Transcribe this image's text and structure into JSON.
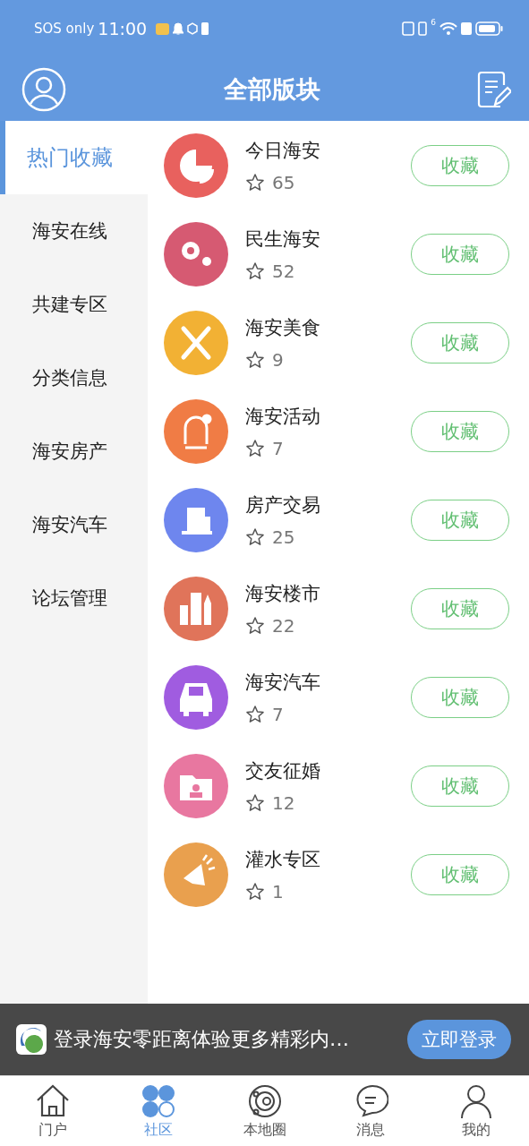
{
  "status_bar": {
    "carrier": "SOS only",
    "time": "11:00",
    "network_badge": "6"
  },
  "header": {
    "title": "全部版块"
  },
  "sidebar": {
    "items": [
      {
        "label": "热门收藏",
        "selected": true
      },
      {
        "label": "海安在线",
        "selected": false
      },
      {
        "label": "共建专区",
        "selected": false
      },
      {
        "label": "分类信息",
        "selected": false
      },
      {
        "label": "海安房产",
        "selected": false
      },
      {
        "label": "海安汽车",
        "selected": false
      },
      {
        "label": "论坛管理",
        "selected": false
      }
    ]
  },
  "forums": [
    {
      "name": "今日海安",
      "count": "65",
      "color": "#e8615e",
      "button": "收藏"
    },
    {
      "name": "民生海安",
      "count": "52",
      "color": "#d65a72",
      "button": "收藏"
    },
    {
      "name": "海安美食",
      "count": "9",
      "color": "#f2b134",
      "button": "收藏"
    },
    {
      "name": "海安活动",
      "count": "7",
      "color": "#f07c45",
      "button": "收藏"
    },
    {
      "name": "房产交易",
      "count": "25",
      "color": "#6e86ee",
      "button": "收藏"
    },
    {
      "name": "海安楼市",
      "count": "22",
      "color": "#e0745a",
      "button": "收藏"
    },
    {
      "name": "海安汽车",
      "count": "7",
      "color": "#a05ce0",
      "button": "收藏"
    },
    {
      "name": "交友征婚",
      "count": "12",
      "color": "#e877a0",
      "button": "收藏"
    },
    {
      "name": "灌水专区",
      "count": "1",
      "color": "#e9a04e",
      "button": "收藏"
    }
  ],
  "login_banner": {
    "text": "登录海安零距离体验更多精彩内…",
    "button": "立即登录"
  },
  "tab_bar": [
    {
      "label": "门户",
      "selected": false
    },
    {
      "label": "社区",
      "selected": true
    },
    {
      "label": "本地圈",
      "selected": false
    },
    {
      "label": "消息",
      "selected": false
    },
    {
      "label": "我的",
      "selected": false
    }
  ]
}
